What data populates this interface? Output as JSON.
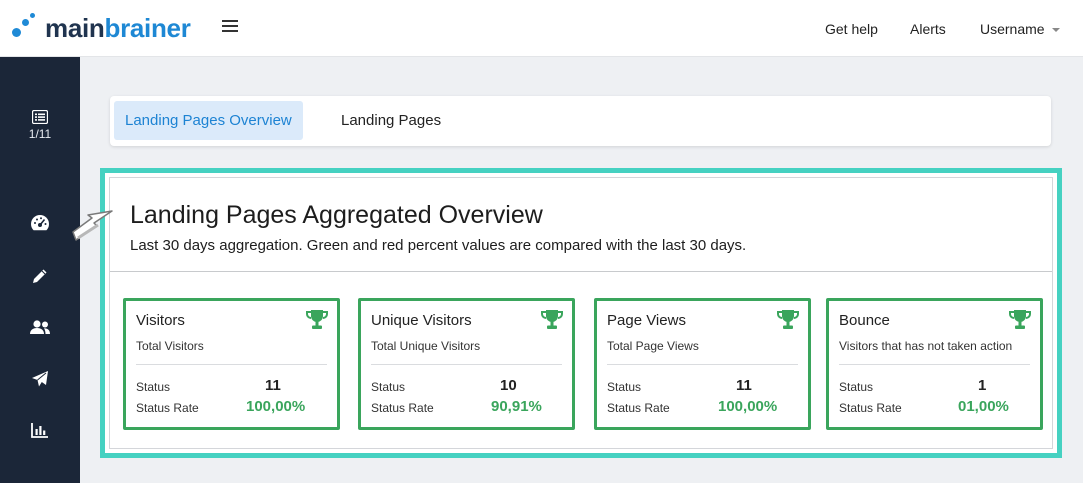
{
  "app": {
    "logo_part1": "main",
    "logo_part2": "brainer",
    "brand_color": "#1e88d4",
    "dark_color": "#20344f"
  },
  "header": {
    "menu_icon": "hamburger-icon",
    "links": {
      "help": "Get help",
      "alerts": "Alerts",
      "username": "Username"
    }
  },
  "sidebar": {
    "background": "#1b2638",
    "items": [
      {
        "icon": "list-icon",
        "label": "1/11"
      },
      {
        "icon": "dashboard-icon"
      },
      {
        "icon": "pencil-icon"
      },
      {
        "icon": "users-icon"
      },
      {
        "icon": "send-icon"
      },
      {
        "icon": "bar-chart-icon"
      }
    ]
  },
  "tabs": [
    {
      "label": "Landing Pages Overview",
      "active": true
    },
    {
      "label": "Landing Pages",
      "active": false
    }
  ],
  "overview": {
    "title": "Landing Pages Aggregated Overview",
    "subtitle": "Last 30 days aggregation. Green and red percent values are compared with the last 30 days.",
    "highlight_color": "#45d1c1",
    "accent_green": "#3aa55c",
    "cards": [
      {
        "title": "Visitors",
        "description": "Total Visitors",
        "status_label": "Status",
        "status_value": "11",
        "rate_label": "Status Rate",
        "rate_value": "100,00%",
        "icon": "trophy-icon"
      },
      {
        "title": "Unique Visitors",
        "description": "Total Unique Visitors",
        "status_label": "Status",
        "status_value": "10",
        "rate_label": "Status Rate",
        "rate_value": "90,91%",
        "icon": "trophy-icon"
      },
      {
        "title": "Page Views",
        "description": "Total Page Views",
        "status_label": "Status",
        "status_value": "11",
        "rate_label": "Status Rate",
        "rate_value": "100,00%",
        "icon": "trophy-icon"
      },
      {
        "title": "Bounce",
        "description": "Visitors that has not taken action",
        "status_label": "Status",
        "status_value": "1",
        "rate_label": "Status Rate",
        "rate_value": "01,00%",
        "icon": "trophy-icon"
      }
    ]
  }
}
